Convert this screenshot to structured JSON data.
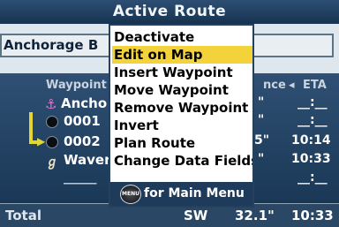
{
  "screen": {
    "title": "Active Route",
    "route_name": "Anchorage B"
  },
  "table": {
    "headers": {
      "waypoint": "Waypoint",
      "distance": "nce",
      "eta": "ETA"
    },
    "rows": [
      {
        "name": "Ancho",
        "icon": "anchor-icon",
        "dist": "\"",
        "eta": "__:__"
      },
      {
        "name": "0001",
        "icon": "waypoint-dot-icon",
        "dist": "\"",
        "eta": "__:__"
      },
      {
        "name": "0002",
        "icon": "waypoint-dot-icon",
        "dist": "5\"",
        "eta": "10:14"
      },
      {
        "name": "Waver",
        "icon": "flag-icon",
        "dist": "\"",
        "eta": "10:33"
      },
      {
        "name": "_____",
        "icon": "",
        "dist": "",
        "eta": "__:__"
      }
    ]
  },
  "total": {
    "label": "Total",
    "course": "SW",
    "distance": "32.1\"",
    "eta": "10:33"
  },
  "menu": {
    "items": [
      {
        "label": "Deactivate",
        "selected": false
      },
      {
        "label": "Edit on Map",
        "selected": true
      },
      {
        "label": "Insert Waypoint",
        "selected": false
      },
      {
        "label": "Move Waypoint",
        "selected": false
      },
      {
        "label": "Remove Waypoint",
        "selected": false
      },
      {
        "label": "Invert",
        "selected": false
      },
      {
        "label": "Plan Route",
        "selected": false
      },
      {
        "label": "Change Data Fields",
        "selected": false
      }
    ],
    "footer_button": "MENU",
    "footer_text": "for Main Menu"
  },
  "colors": {
    "accent_selected": "#f3d23a",
    "title_bg": "#1f3b5c",
    "table_bg": "#2a4866"
  }
}
